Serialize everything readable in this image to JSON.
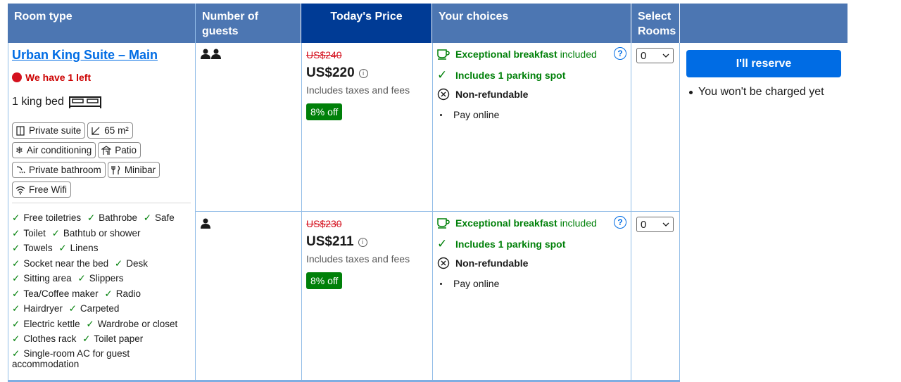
{
  "headers": {
    "room_type": "Room type",
    "guests": "Number of guests",
    "price": "Today's Price",
    "choices": "Your choices",
    "select_line1": "Select",
    "select_line2": "Rooms"
  },
  "room": {
    "name": "Urban King Suite – Main",
    "availability": "We have 1 left",
    "bed": "1 king bed",
    "tags": [
      "Private suite",
      "65 m²",
      "Air conditioning",
      "Patio",
      "Private bathroom",
      "Minibar",
      "Free Wifi"
    ],
    "amenities": [
      "Free toiletries",
      "Bathrobe",
      "Safe",
      "Toilet",
      "Bathtub or shower",
      "Towels",
      "Linens",
      "Socket near the bed",
      "Desk",
      "Sitting area",
      "Slippers",
      "Tea/Coffee maker",
      "Radio",
      "Hairdryer",
      "Carpeted",
      "Electric kettle",
      "Wardrobe or closet",
      "Clothes rack",
      "Toilet paper",
      "Single-room AC for guest accommodation"
    ]
  },
  "options": [
    {
      "old_price": "US$240",
      "price": "US$220",
      "taxes": "Includes taxes and fees",
      "discount": "8% off",
      "breakfast_bold": "Exceptional breakfast",
      "breakfast_rest": " included",
      "parking": "Includes 1 parking spot",
      "refund": "Non-refundable",
      "pay": "Pay online",
      "rooms_selected": "0"
    },
    {
      "old_price": "US$230",
      "price": "US$211",
      "taxes": "Includes taxes and fees",
      "discount": "8% off",
      "breakfast_bold": "Exceptional breakfast",
      "breakfast_rest": " included",
      "parking": "Includes 1 parking spot",
      "refund": "Non-refundable",
      "pay": "Pay online",
      "rooms_selected": "0"
    }
  ],
  "reserve": {
    "button": "I'll reserve",
    "note": "You won't be charged yet"
  },
  "colors": {
    "header": "#4c76b2",
    "header_price": "#003b95",
    "link": "#006ce4",
    "green": "#008009",
    "red": "#d4111e"
  }
}
